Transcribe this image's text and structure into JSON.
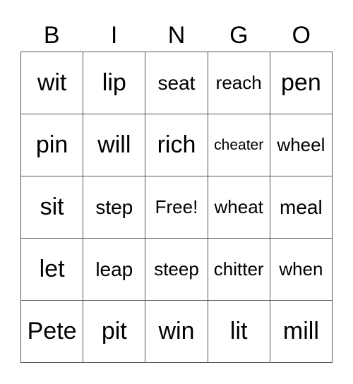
{
  "header": [
    "B",
    "I",
    "N",
    "G",
    "O"
  ],
  "cells": [
    [
      "wit",
      "lip",
      "seat",
      "reach",
      "pen"
    ],
    [
      "pin",
      "will",
      "rich",
      "cheater",
      "wheel"
    ],
    [
      "sit",
      "step",
      "Free!",
      "wheat",
      "meal"
    ],
    [
      "let",
      "leap",
      "steep",
      "chitter",
      "when"
    ],
    [
      "Pete",
      "pit",
      "win",
      "lit",
      "mill"
    ]
  ]
}
